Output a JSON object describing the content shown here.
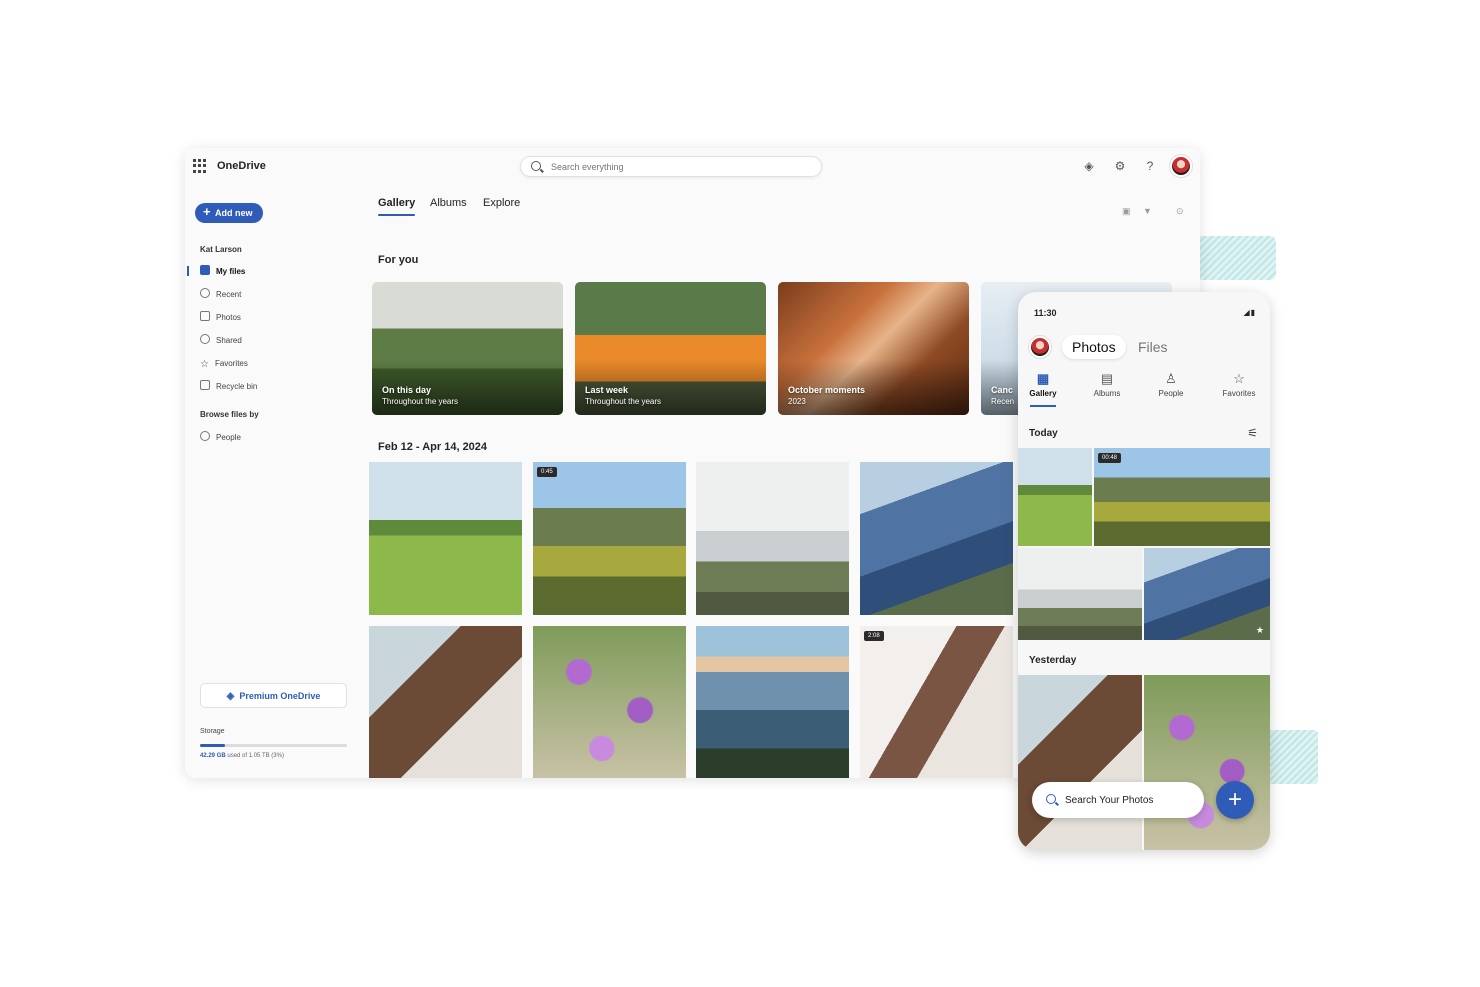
{
  "app": {
    "title": "OneDrive"
  },
  "search": {
    "placeholder": "Search everything"
  },
  "toolbar": {
    "premium_icon": "diamond-icon",
    "settings_icon": "gear-icon",
    "help_label": "?"
  },
  "sidebar": {
    "add_new": "Add new",
    "user": "Kat Larson",
    "items": [
      {
        "label": "My files",
        "icon": "folder-icon",
        "active": true
      },
      {
        "label": "Recent",
        "icon": "clock-icon"
      },
      {
        "label": "Photos",
        "icon": "image-icon"
      },
      {
        "label": "Shared",
        "icon": "people-icon"
      },
      {
        "label": "Favorites",
        "icon": "star-icon"
      },
      {
        "label": "Recycle bin",
        "icon": "trash-icon"
      }
    ],
    "browse_heading": "Browse files by",
    "browse_items": [
      {
        "label": "People",
        "icon": "person-icon"
      }
    ],
    "premium": "Premium OneDrive",
    "storage_label": "Storage",
    "storage_used": "42.29 GB",
    "storage_text": "used of 1.05 TB (3%)",
    "storage_fraction": 0.17
  },
  "tabs": [
    {
      "label": "Gallery",
      "active": true
    },
    {
      "label": "Albums"
    },
    {
      "label": "Explore"
    }
  ],
  "for_you": {
    "heading": "For you",
    "cards": [
      {
        "title": "On this day",
        "subtitle": "Throughout the years"
      },
      {
        "title": "Last week",
        "subtitle": "Throughout the years"
      },
      {
        "title": "October moments",
        "subtitle": "2023"
      },
      {
        "title": "Canc",
        "subtitle": "Recen"
      }
    ]
  },
  "date_range": {
    "heading": "Feb 12 - Apr 14, 2024"
  },
  "grid_durations": {
    "tile2": "0:45",
    "tile8": "2:08"
  },
  "phone": {
    "time": "11:30",
    "status": "◢▮",
    "tabs": [
      {
        "label": "Photos",
        "active": true
      },
      {
        "label": "Files"
      }
    ],
    "nav": [
      {
        "label": "Gallery",
        "icon": "gallery-icon",
        "active": true
      },
      {
        "label": "Albums",
        "icon": "album-icon"
      },
      {
        "label": "People",
        "icon": "person-icon"
      },
      {
        "label": "Favorites",
        "icon": "star-icon"
      }
    ],
    "today": "Today",
    "video_duration": "00:48",
    "yesterday": "Yesterday",
    "search_label": "Search Your Photos",
    "fab_label": "+"
  }
}
